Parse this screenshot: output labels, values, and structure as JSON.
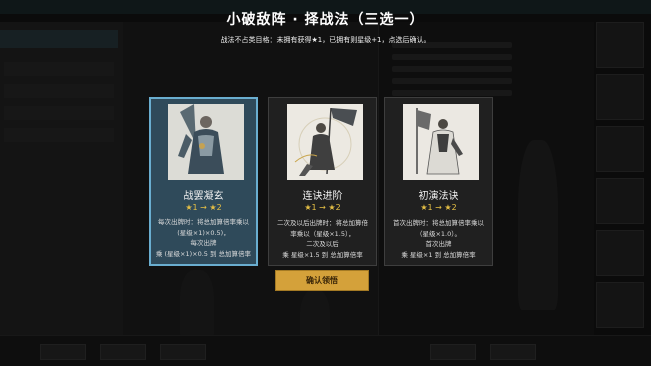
{
  "modal": {
    "title": "小破敌阵 · 择战法（三选一）",
    "subtitle": "战法不占类目格：未拥有获得★1，已拥有则星级+1，点选后确认。",
    "confirm_label": "确认领悟"
  },
  "cards": [
    {
      "name": "战罢凝玄",
      "stars": "★1 → ★2",
      "desc": [
        "每次出牌时：将总加算倍率乘以",
        "(星级×1)×0.5)，",
        "每次出牌",
        "乘 (星级×1)×0.5 到 总加算倍率"
      ],
      "selected": true
    },
    {
      "name": "连诀进阶",
      "stars": "★1 → ★2",
      "desc": [
        "二次及以后出牌时：将总加算倍",
        "率乘以（星级×1.5），",
        "二次及以后",
        "乘 星级×1.5 到 总加算倍率"
      ],
      "selected": false
    },
    {
      "name": "初演法诀",
      "stars": "★1 → ★2",
      "desc": [
        "首次出牌时：将总加算倍率乘以",
        "（星级×1.0）。",
        "首次出牌",
        "乘 星级×1 到 总加算倍率"
      ],
      "selected": false
    }
  ],
  "colors": {
    "selected_border": "#6aaed0",
    "selected_bg": "#2f4a5a",
    "star": "#e6c045",
    "confirm_bg": "#d4a13a"
  }
}
